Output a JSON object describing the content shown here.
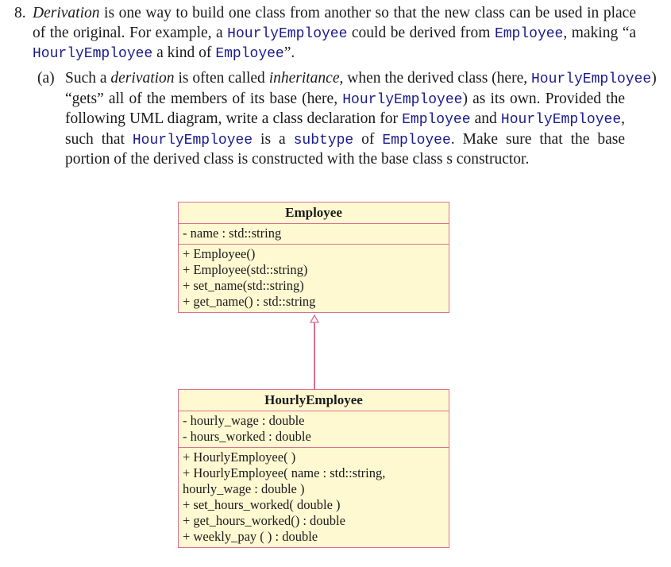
{
  "question": {
    "number": "8.",
    "intro": {
      "term": "Derivation",
      "t1": " is one way to build one class from another so that the new class can be used in place of the original. For example, a ",
      "code1": "HourlyEmployee",
      "t2": " could be derived from ",
      "code2": "Employee",
      "t3": ", making “a ",
      "code3": "HourlyEmployee",
      "t4": " a kind of ",
      "code4": "Employee",
      "t5": "”."
    },
    "part_a": {
      "label": "(a)",
      "t1": "Such a ",
      "em1": "derivation",
      "t2": " is often called ",
      "em2": "inheritance",
      "t3": ", when the derived class (here, ",
      "code1": "HourlyEmployee",
      "t4": ")",
      "t5": "“gets” all of the members of its base (here, ",
      "code2": "HourlyEmployee",
      "t6": ") as its own. Provided the following UML diagram, write a class declaration for ",
      "code3": "Employee",
      "t7": " and ",
      "code4": "HourlyEmployee",
      "t8": ", such that ",
      "code5": "HourlyEmployee",
      "t9": " is a ",
      "code6": "subtype",
      "t10": " of ",
      "code7": "Employee",
      "t11": ". Make sure that the base portion of the derived class is constructed with the base class s constructor."
    }
  },
  "uml": {
    "base": {
      "name": "Employee",
      "attributes": [
        "- name : std::string"
      ],
      "methods": [
        "+ Employee()",
        "+ Employee(std::string)",
        "+ set_name(std::string)",
        "+ get_name() : std::string"
      ]
    },
    "derived": {
      "name": "HourlyEmployee",
      "attributes": [
        "- hourly_wage : double",
        "- hours_worked : double"
      ],
      "methods": [
        "+ HourlyEmployee( )",
        "+ HourlyEmployee( name : std::string,",
        "hourly_wage : double )",
        "+ set_hours_worked( double )",
        "+ get_hours_worked() : double",
        "+ weekly_pay ( ) : double"
      ]
    },
    "relationship": "inheritance",
    "colors": {
      "box_fill": "#fff9d2",
      "border": "#dd6f8f",
      "code_text": "#1a1a8c"
    }
  }
}
